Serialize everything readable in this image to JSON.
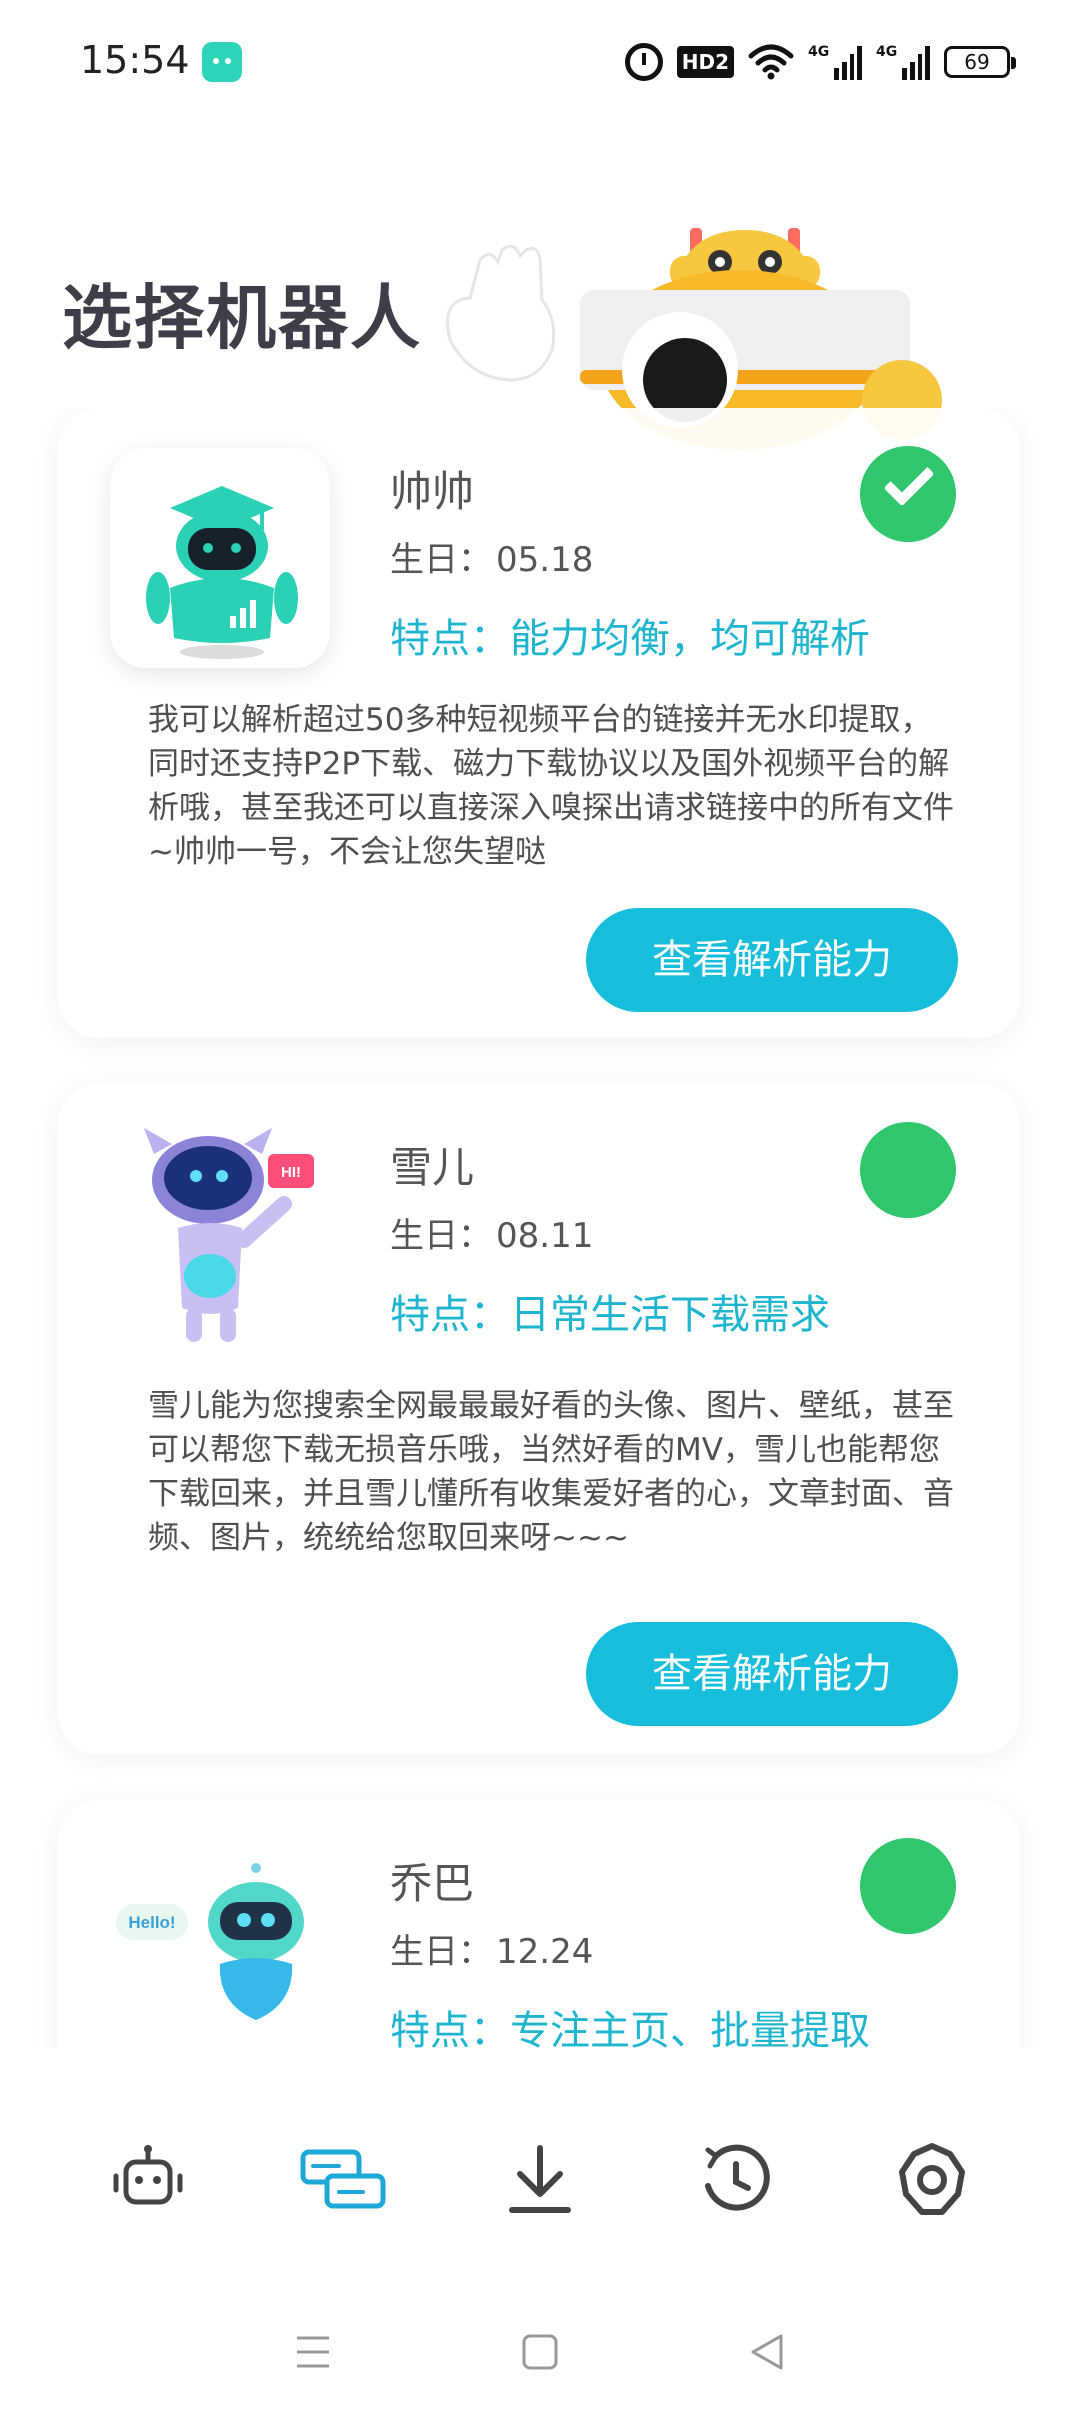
{
  "status_bar": {
    "time": "15:54",
    "hd_label": "HD2",
    "signal1_label": "4G",
    "signal2_label": "4G",
    "battery": "69"
  },
  "header": {
    "title": "选择机器人"
  },
  "robots": [
    {
      "name": "帅帅",
      "birthday_label": "生日：",
      "birthday": "05.18",
      "feature": "特点：能力均衡，均可解析",
      "selected": true,
      "description": "我可以解析超过50多种短视频平台的链接并无水印提取，同时还支持P2P下载、磁力下载协议以及国外视频平台的解析哦，甚至我还可以直接深入嗅探出请求链接中的所有文件~帅帅一号，不会让您失望哒",
      "button_label": "查看解析能力"
    },
    {
      "name": "雪儿",
      "birthday_label": "生日：",
      "birthday": "08.11",
      "feature": "特点：日常生活下载需求",
      "selected": false,
      "description": "雪儿能为您搜索全网最最最好看的头像、图片、壁纸，甚至可以帮您下载无损音乐哦，当然好看的MV，雪儿也能帮您下载回来，并且雪儿懂所有收集爱好者的心，文章封面、音频、图片，统统给您取回来呀~~~",
      "button_label": "查看解析能力",
      "avatar_badge": "HI!"
    },
    {
      "name": "乔巴",
      "birthday_label": "生日：",
      "birthday": "12.24",
      "feature": "特点：专注主页、批量提取",
      "selected": false,
      "avatar_badge": "Hello!"
    }
  ],
  "tab_bar": {
    "items": [
      {
        "icon": "robot-icon",
        "active": false
      },
      {
        "icon": "parse-cards-icon",
        "active": true
      },
      {
        "icon": "download-icon",
        "active": false
      },
      {
        "icon": "history-icon",
        "active": false
      },
      {
        "icon": "settings-icon",
        "active": false
      }
    ]
  },
  "colors": {
    "accent": "#17bedc",
    "selected": "#2fc66c",
    "feature_text": "#1fb5cf",
    "title": "#3e3e48"
  }
}
